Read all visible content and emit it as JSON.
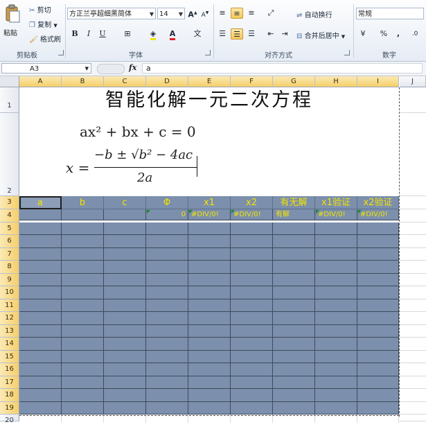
{
  "ribbon": {
    "clipboard": {
      "paste": "粘贴",
      "cut": "剪切",
      "copy": "复制",
      "format_painter": "格式刷",
      "label": "剪贴板"
    },
    "font": {
      "name": "方正兰亭超细黑简体",
      "size": "14",
      "grow": "A",
      "shrink": "A",
      "bold": "B",
      "italic": "I",
      "underline": "U",
      "label": "字体"
    },
    "alignment": {
      "wrap_text": "自动换行",
      "merge_center": "合并后居中",
      "label": "对齐方式"
    },
    "number": {
      "format": "常规",
      "percent": "%",
      "comma": ",",
      "label": "数字"
    }
  },
  "formula_bar": {
    "name_box": "A3",
    "fx": "fx",
    "content": "a"
  },
  "columns": [
    "A",
    "B",
    "C",
    "D",
    "E",
    "F",
    "G",
    "H",
    "I",
    "J"
  ],
  "rows": [
    "1",
    "2",
    "3",
    "4",
    "5",
    "6",
    "7",
    "8",
    "9",
    "10",
    "11",
    "12",
    "13",
    "14",
    "15",
    "16",
    "17",
    "18",
    "19",
    "20"
  ],
  "sheet": {
    "title": "智能化解一元二次方程",
    "eq_standard": "ax² + bx + c = 0",
    "eq_root_lhs": "x =",
    "eq_root_num": "−b ± √b² − 4ac",
    "eq_root_den": "2a",
    "headers": [
      "a",
      "b",
      "c",
      "Φ",
      "x1",
      "x2",
      "有无解",
      "x1验证",
      "x2验证"
    ],
    "row4": [
      "",
      "",
      "",
      "0",
      "#DIV/0!",
      "#DIV/0!",
      "有解",
      "#DIV/0!",
      "#DIV/0!"
    ]
  },
  "colors": {
    "table_fill": "#7c8fac",
    "header_text": "#f2e300",
    "selection": "#f5cf6a"
  }
}
